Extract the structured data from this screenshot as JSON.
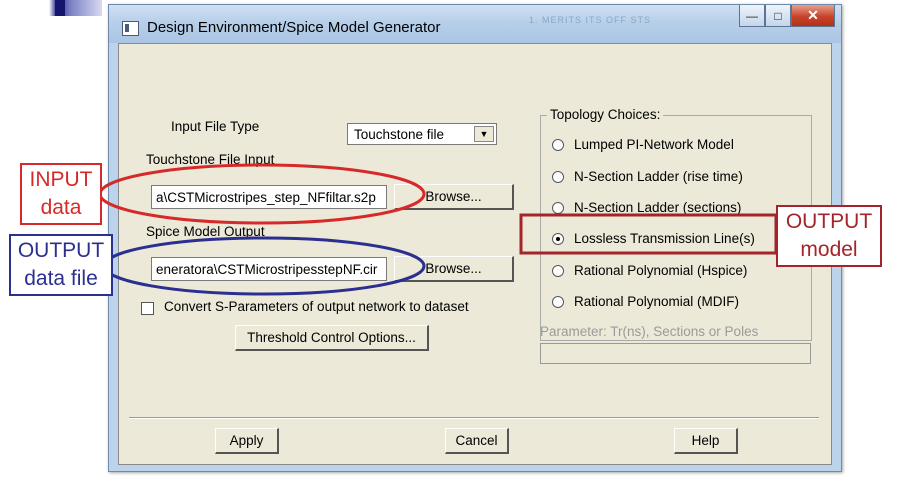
{
  "window": {
    "title": "Design Environment/Spice Model Generator",
    "title_faint": "1. MERITS ITS OFF STS",
    "minimize_glyph": "—",
    "maximize_glyph": "□",
    "close_glyph": "✕"
  },
  "form": {
    "input_file_type_label": "Input File Type",
    "input_file_type_value": "Touchstone file",
    "touchstone_input_label": "Touchstone File Input",
    "touchstone_input_value": "a\\CSTMicrostripes_step_NFfiltar.s2p",
    "browse_label": "Browse...",
    "spice_output_label": "Spice Model Output",
    "spice_output_value": "eneratora\\CSTMicrostripesstepNF.cir",
    "convert_checkbox_label": "Convert S-Parameters of output network to dataset",
    "convert_checked": false,
    "threshold_button": "Threshold Control Options..."
  },
  "topology": {
    "title": "Topology Choices:",
    "options": [
      {
        "label": "Lumped PI-Network Model",
        "selected": false
      },
      {
        "label": "N-Section Ladder (rise time)",
        "selected": false
      },
      {
        "label": "N-Section Ladder (sections)",
        "selected": false
      },
      {
        "label": "Lossless Transmission Line(s)",
        "selected": true
      },
      {
        "label": "Rational Polynomial (Hspice)",
        "selected": false
      },
      {
        "label": "Rational Polynomial (MDIF)",
        "selected": false
      }
    ],
    "parameter_label": "Parameter: Tr(ns), Sections or Poles",
    "parameter_value": ""
  },
  "footer": {
    "apply": "Apply",
    "cancel": "Cancel",
    "help": "Help"
  },
  "annotations": {
    "input_line1": "INPUT",
    "input_line2": "data",
    "output_data_line1": "OUTPUT",
    "output_data_line2": "data file",
    "output_model_line1": "OUTPUT",
    "output_model_line2": "model",
    "colors": {
      "red": "#d62a2a",
      "blue": "#2b2f8f",
      "dark_red": "#a3242a"
    }
  }
}
